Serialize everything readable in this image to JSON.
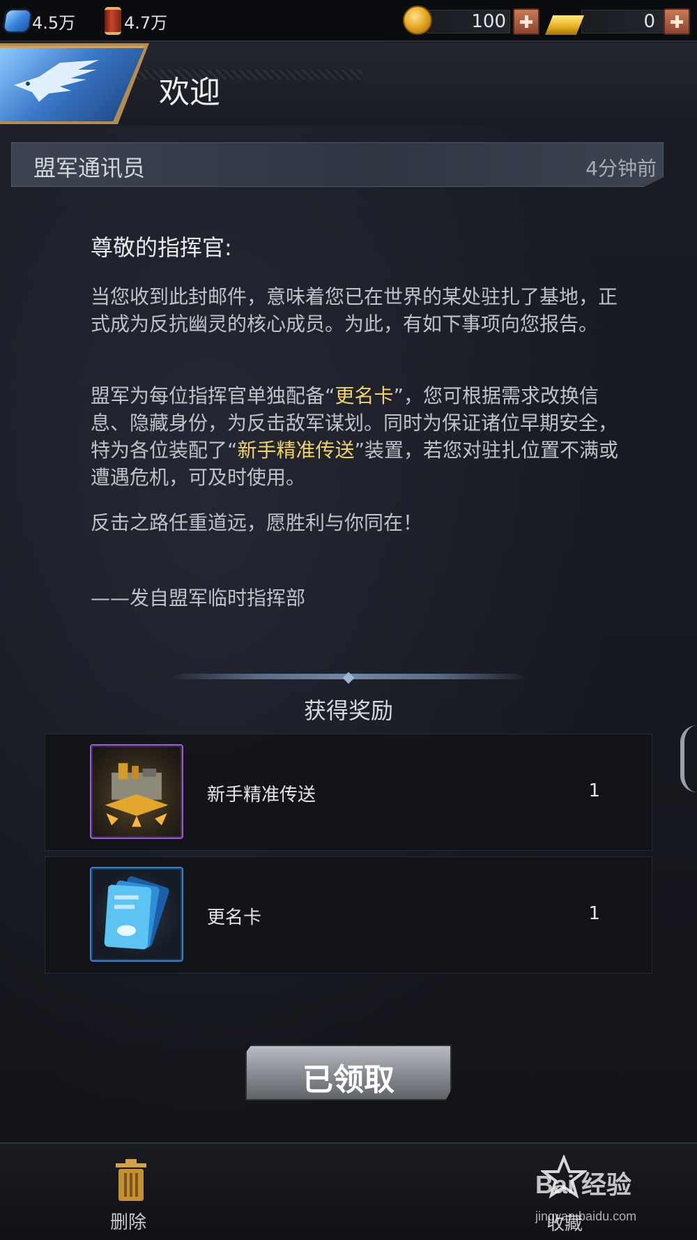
{
  "resources": {
    "crystal_amount": "4.5万",
    "oil_amount": "4.7万",
    "coin_amount": "100",
    "gold_amount": "0"
  },
  "header": {
    "title": "欢迎"
  },
  "mail": {
    "sender": "盟军通讯员",
    "time": "4分钟前",
    "greeting": "尊敬的指挥官:",
    "paragraph1": "当您收到此封邮件，意味着您已在世界的某处驻扎了基地，正式成为反抗幽灵的核心成员。为此，有如下事项向您报告。",
    "paragraph2_a": "盟军为每位指挥官单独配备“",
    "paragraph2_hl1": "更名卡",
    "paragraph2_b": "”，您可根据需求改换信息、隐藏身份，为反击敌军谋划。同时为保证诸位早期安全，特为各位装配了“",
    "paragraph2_hl2": "新手精准传送",
    "paragraph2_c": "”装置，若您对驻扎位置不满或遭遇危机，可及时使用。",
    "paragraph3": "反击之路任重道远，愿胜利与你同在！",
    "signature": "——发自盟军临时指挥部"
  },
  "rewards": {
    "title": "获得奖励",
    "items": [
      {
        "name": "新手精准传送",
        "count": "1",
        "icon": "teleport-icon"
      },
      {
        "name": "更名卡",
        "count": "1",
        "icon": "rename-card-icon"
      }
    ]
  },
  "claim_button": {
    "label": "已领取"
  },
  "bottom": {
    "delete_label": "删除",
    "favorite_label": "收藏"
  },
  "watermark": {
    "brand": "Bai 经验",
    "url": "jingyan.baidu.com"
  },
  "colors": {
    "highlight": "#f1d36a",
    "background": "#15171f"
  }
}
